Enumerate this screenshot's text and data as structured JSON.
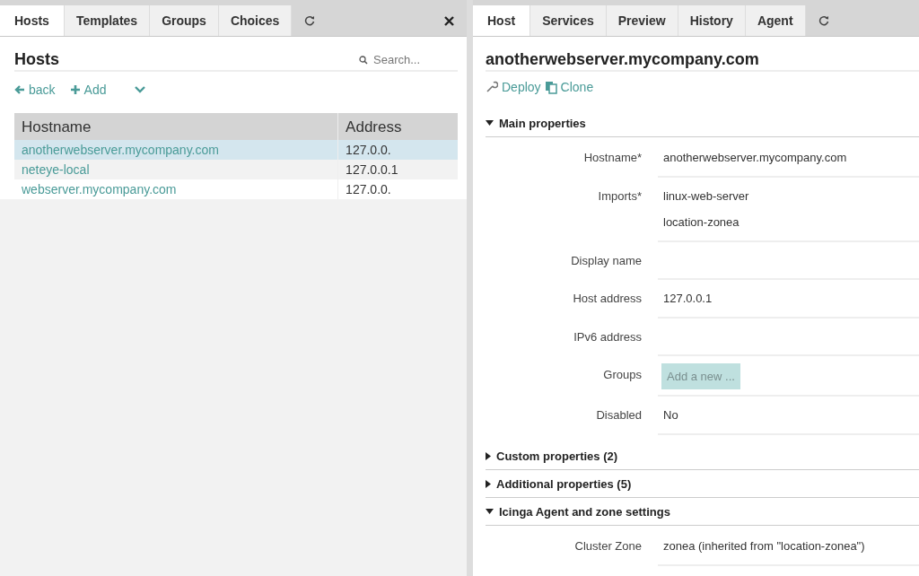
{
  "left_pane": {
    "tabs": [
      {
        "label": "Hosts",
        "selected": true
      },
      {
        "label": "Templates",
        "selected": false
      },
      {
        "label": "Groups",
        "selected": false
      },
      {
        "label": "Choices",
        "selected": false
      }
    ],
    "title": "Hosts",
    "search": {
      "placeholder": "Search..."
    },
    "actions": [
      {
        "kind": "back",
        "label": "back"
      },
      {
        "kind": "add",
        "label": "Add"
      },
      {
        "kind": "more"
      }
    ],
    "table": {
      "columns": [
        "Hostname",
        "Address"
      ],
      "rows": [
        {
          "cells": [
            "anotherwebserver.mycompany.com",
            "127.0.0."
          ],
          "selected": true
        },
        {
          "cells": [
            "neteye-local",
            "127.0.0.1"
          ],
          "selected": false
        },
        {
          "cells": [
            "webserver.mycompany.com",
            "127.0.0."
          ],
          "selected": false
        }
      ]
    }
  },
  "right_pane": {
    "tabs": [
      {
        "label": "Host",
        "selected": true
      },
      {
        "label": "Services",
        "selected": false
      },
      {
        "label": "Preview",
        "selected": false
      },
      {
        "label": "History",
        "selected": false
      },
      {
        "label": "Agent",
        "selected": false
      }
    ],
    "title": "anotherwebserver.mycompany.com",
    "actions": [
      {
        "kind": "deploy",
        "label": "Deploy"
      },
      {
        "kind": "clone",
        "label": "Clone"
      }
    ],
    "sections": [
      {
        "title": "Main properties",
        "expanded": true,
        "fields": [
          {
            "label": "Hostname*",
            "kind": "text",
            "values": [
              "anotherwebserver.mycompany.com"
            ]
          },
          {
            "label": "Imports*",
            "kind": "text",
            "values": [
              "linux-web-server",
              "location-zonea"
            ]
          },
          {
            "label": "Display name",
            "kind": "text"
          },
          {
            "label": "Host address",
            "kind": "text",
            "values": [
              "127.0.0.1"
            ]
          },
          {
            "label": "IPv6 address",
            "kind": "text"
          },
          {
            "label": "Groups",
            "kind": "button",
            "values": [
              "Add a new ..."
            ]
          },
          {
            "label": "Disabled",
            "kind": "text",
            "values": [
              "No"
            ]
          }
        ]
      },
      {
        "title": "Custom properties (2)",
        "expanded": false
      },
      {
        "title": "Additional properties (5)",
        "expanded": false
      },
      {
        "title": "Icinga Agent and zone settings",
        "expanded": true,
        "fields": [
          {
            "label": "Cluster Zone",
            "kind": "text",
            "values": [
              "zonea (inherited from \"location-zonea\")"
            ]
          }
        ]
      }
    ]
  }
}
